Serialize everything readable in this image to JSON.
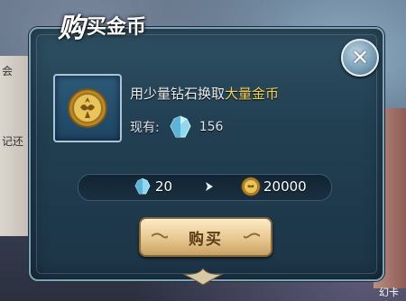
{
  "background": {
    "left_snippets": [
      "会",
      "记还"
    ],
    "corner_text": "幻卡"
  },
  "dialog": {
    "title_big": "购",
    "title_rest": "买金币",
    "close_glyph": "✕",
    "item_icon": "gold-coin-icon",
    "desc_prefix": "用少量钻石换取",
    "desc_highlight": "大量金币",
    "owned_label": "现有:",
    "owned_diamonds": "156",
    "exchange": {
      "cost": "20",
      "gain": "20000"
    },
    "buy_label": "购买"
  },
  "colors": {
    "highlight": "#f2d35a",
    "panel": "#223f52",
    "button": "#e6c88f"
  }
}
